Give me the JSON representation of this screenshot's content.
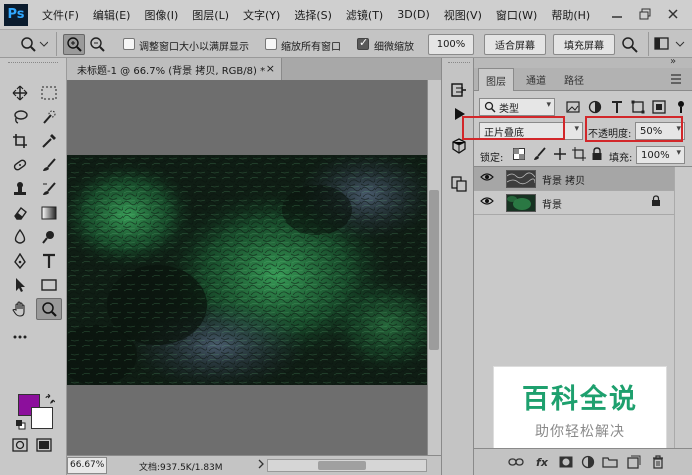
{
  "app": {
    "logo_text": "Ps",
    "menu": [
      "文件(F)",
      "编辑(E)",
      "图像(I)",
      "图层(L)",
      "文字(Y)",
      "选择(S)",
      "滤镜(T)",
      "3D(D)",
      "视图(V)",
      "窗口(W)",
      "帮助(H)"
    ]
  },
  "options_bar": {
    "resize_windows_label": "调整窗口大小以满屏显示",
    "zoom_all_label": "缩放所有窗口",
    "scrubby_zoom_label": "细微缩放",
    "zoom_percent": "100%",
    "fit_screen_label": "适合屏幕",
    "fill_screen_label": "填充屏幕",
    "scrubby_zoom_checked": true
  },
  "document": {
    "tab_title": "未标题-1 @ 66.7% (背景 拷贝, RGB/8) *",
    "close_glyph": "×",
    "zoom_status": "66.67%",
    "doc_size": "文档:937.5K/1.83M"
  },
  "colors": {
    "foreground": "#8c0f9c",
    "background": "#ffffff",
    "accent_red": "#d2272a"
  },
  "layers_panel": {
    "tabs": [
      "图层",
      "通道",
      "路径"
    ],
    "filter_kind": "类型",
    "blend_mode": "正片叠底",
    "opacity_label": "不透明度:",
    "opacity_value": "50%",
    "lock_label": "锁定:",
    "fill_label": "填充:",
    "fill_value": "100%",
    "layers": [
      {
        "name": "背景 拷贝",
        "selected": true,
        "locked": false
      },
      {
        "name": "背景",
        "selected": false,
        "locked": true
      }
    ],
    "footer_fx": "fx"
  },
  "watermark": {
    "title": "百科全说",
    "subtitle": "助你轻松解决"
  }
}
